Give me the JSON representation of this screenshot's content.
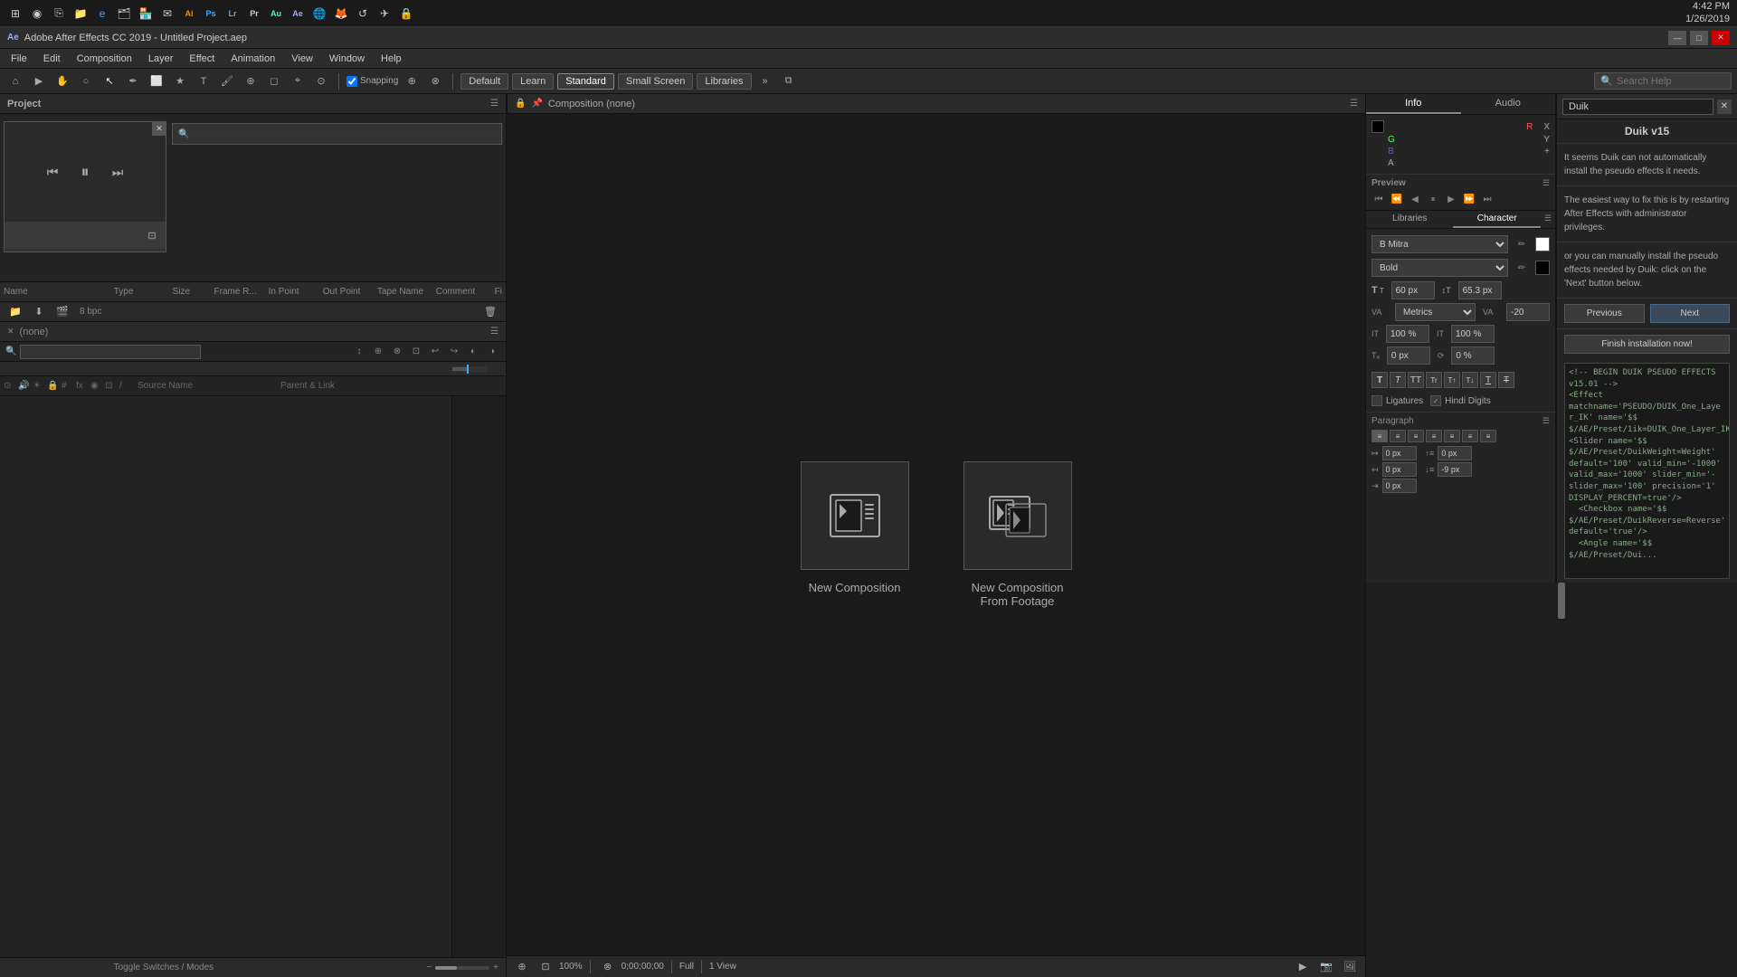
{
  "taskbar": {
    "time": "4:42 PM",
    "date": "1/26/2019",
    "system_icons": [
      "⊞",
      "●",
      "⎘",
      "📁",
      "🌐",
      "📧",
      "Ai",
      "Ps",
      "Lr",
      "Pr",
      "Au",
      "Ae",
      "🎵",
      "🌐",
      "🔥",
      "↺",
      "✈",
      "🔒"
    ]
  },
  "titlebar": {
    "title": "Adobe After Effects CC 2019 - Untitled Project.aep",
    "controls": [
      "—",
      "□",
      "✕"
    ]
  },
  "menubar": {
    "items": [
      "File",
      "Edit",
      "Composition",
      "Layer",
      "Effect",
      "Animation",
      "View",
      "Window",
      "Help"
    ]
  },
  "toolbar": {
    "workspaces": [
      "Default",
      "Learn",
      "Standard",
      "Small Screen",
      "Libraries"
    ],
    "active_workspace": "Standard",
    "snapping": "Snapping",
    "search_placeholder": "Search Help"
  },
  "project_panel": {
    "title": "Project",
    "search_placeholder": "Search",
    "columns": [
      "Name",
      "Type",
      "Size",
      "Frame R...",
      "In Point",
      "Out Point",
      "Tape Name",
      "Comment",
      "Fi"
    ]
  },
  "preview_mini": {
    "close": "✕",
    "transport": [
      "⏮",
      "⏸",
      "⏭"
    ]
  },
  "composition_panel": {
    "title": "Composition (none)",
    "options": [
      {
        "label": "New Composition",
        "icon": "film-composition"
      },
      {
        "label": "New Composition\nFrom Footage",
        "icon": "film-footage"
      }
    ],
    "bottom": {
      "zoom": "100%",
      "timecode": "0;00;00;00",
      "view": "1 View",
      "quality": "Full"
    }
  },
  "duik_panel": {
    "search_placeholder": "Duik",
    "title": "Duik v15",
    "messages": [
      "It seems Duik can not automatically install the pseudo effects it needs.",
      "The easiest way to fix this is by restarting After Effects with administrator privileges.",
      "or you can manually install the pseudo effects needed by Duik: click on the 'Next' button below."
    ],
    "buttons": {
      "previous": "Previous",
      "next": "Next",
      "install": "Finish installation now!"
    },
    "code": "<!-- BEGIN DUIK PSEUDO EFFECTS\nv15.01 -->\n<Effect\nmatchname='PSEUDO/DUIK_One_Laye\nr_IK' name='$$\n$/AE/Preset/1ik=DUIK_One_Layer_IK'>\n<Slider name='$$\n$/AE/Preset/DuikWeight=Weight'\ndefault='100' valid_min='-1000'\nvalid_max='1000' slider_min='-\nslider_max='100' precision='1'\nDISPLAY_PERCENT=true'/>\n  <Checkbox name='$$\n$/AE/Preset/DuikReverse=Reverse'\ndefault='true'/>\n  <Angle name='$$\n$/AE/Preset/Dui..."
  },
  "info_panel": {
    "tabs": [
      "Info",
      "Audio"
    ],
    "active_tab": "Info",
    "values": {
      "R": "",
      "G": "",
      "B": "",
      "A": "",
      "X": "",
      "Y": ""
    }
  },
  "preview_panel": {
    "title": "Preview",
    "transport_icons": [
      "⏮",
      "⏪",
      "⏴",
      "⏸",
      "⏩",
      "⏭"
    ]
  },
  "libraries_character_panel": {
    "tabs": [
      "Libraries",
      "Character"
    ],
    "active_tab": "Character",
    "font": "B Mitra",
    "style": "Bold",
    "size": "60 px",
    "va_size": "65.3 px",
    "tracking_type": "Metrics",
    "tracking_value": "-20",
    "scale_h": "100 %",
    "scale_v": "100 %",
    "rotation": "0 %",
    "style_buttons": [
      "T",
      "T",
      "TT",
      "Tr",
      "T",
      "T",
      "T"
    ],
    "color_swatches": [
      "black",
      "white"
    ],
    "ligatures": {
      "label": "Ligatures",
      "checked": false
    },
    "hindi_digits": {
      "label": "Hindi Digits",
      "checked": true
    }
  },
  "paragraph_panel": {
    "title": "Paragraph",
    "align_buttons": [
      "align-left",
      "align-center",
      "align-right",
      "align-justify-left",
      "align-justify-center",
      "align-justify-right",
      "align-justify-all"
    ],
    "active_align": 0,
    "indent_left": "0 px",
    "indent_right": "0 px",
    "space_before": "0 px",
    "space_after": "-9 px",
    "first_line_indent": "0 px"
  },
  "timeline_panel": {
    "comp_name": "(none)",
    "bottom_label": "Toggle Switches / Modes",
    "columns": [
      "",
      "⊙",
      "🔒",
      "#",
      "fx",
      "◉",
      "⊡",
      "/",
      "Source Name",
      "Parent & Link"
    ]
  }
}
